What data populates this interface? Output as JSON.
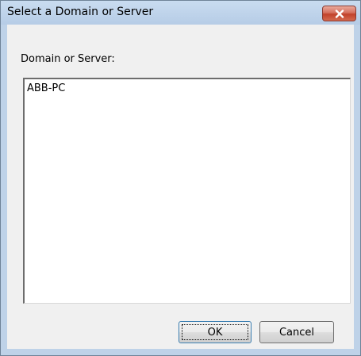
{
  "window": {
    "title": "Select a Domain or Server",
    "close_icon": "close-icon"
  },
  "form": {
    "label": "Domain or Server:",
    "items": [
      "ABB-PC"
    ]
  },
  "buttons": {
    "ok_label": "OK",
    "cancel_label": "Cancel"
  },
  "colors": {
    "frame": "#bed2e8",
    "close_button": "#c1412a",
    "client": "#f0f0f0"
  }
}
